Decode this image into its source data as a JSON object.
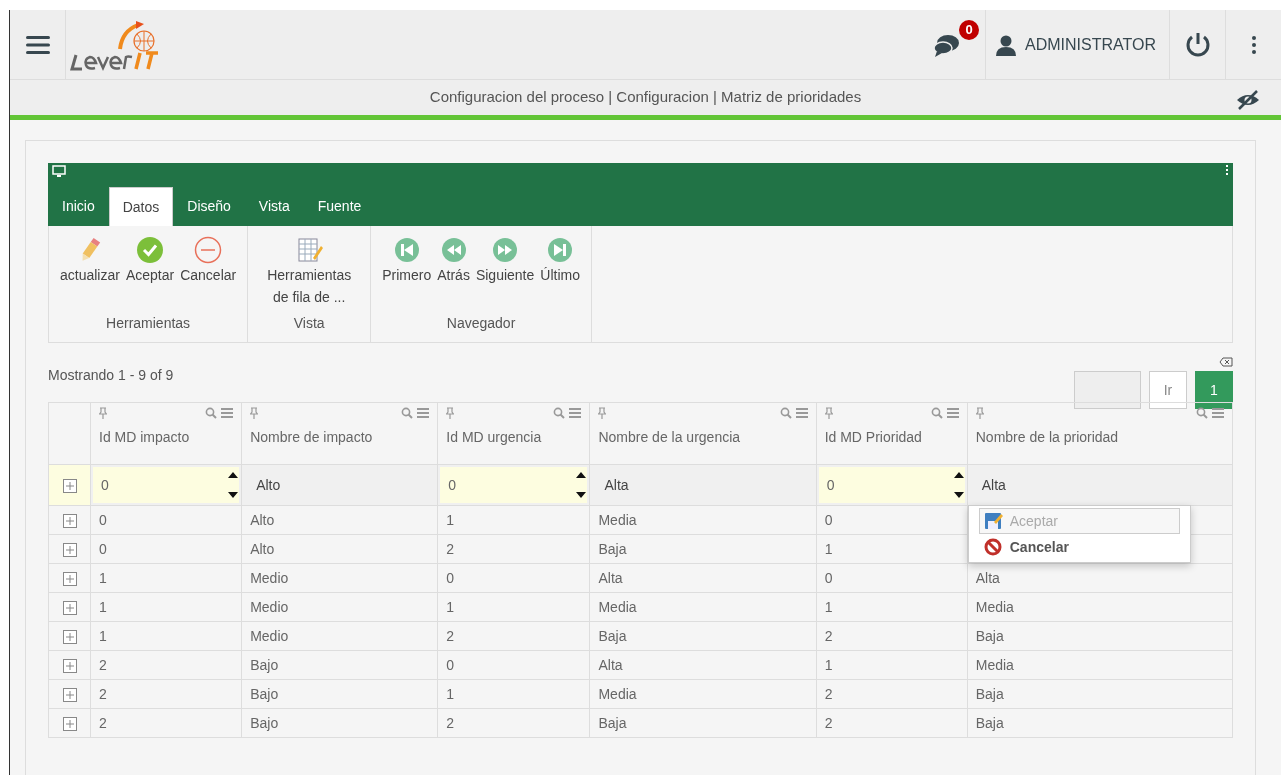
{
  "header": {
    "notifications": "0",
    "user": "ADMINISTRATOR"
  },
  "breadcrumb": "Configuracion del proceso | Configuracion | Matriz de prioridades",
  "ribbon": {
    "tabs": [
      {
        "label": "Inicio",
        "selected": false
      },
      {
        "label": "Datos",
        "selected": true
      },
      {
        "label": "Diseño",
        "selected": false
      },
      {
        "label": "Vista",
        "selected": false
      },
      {
        "label": "Fuente",
        "selected": false
      }
    ],
    "groups": [
      {
        "label": "Herramientas",
        "buttons": [
          {
            "label": "actualizar",
            "kind": "pencil"
          },
          {
            "label": "Aceptar",
            "kind": "accept"
          },
          {
            "label": "Cancelar",
            "kind": "cancel"
          }
        ]
      },
      {
        "label": "Vista",
        "buttons": [
          {
            "label": "Herramientas de fila de ...",
            "kind": "sheet"
          }
        ]
      },
      {
        "label": "Navegador",
        "buttons": [
          {
            "label": "Primero",
            "kind": "first"
          },
          {
            "label": "Atrás",
            "kind": "prev"
          },
          {
            "label": "Siguiente",
            "kind": "next"
          },
          {
            "label": "Último",
            "kind": "last"
          }
        ]
      }
    ]
  },
  "pager": {
    "summary": "Mostrando 1 - 9 of 9",
    "go": "Ir",
    "pages": [
      {
        "label": "1",
        "selected": true
      }
    ]
  },
  "table": {
    "columns": [
      {
        "label": "Id MD impacto",
        "kind": "number"
      },
      {
        "label": "Nombre de impacto",
        "kind": "text"
      },
      {
        "label": "Id MD urgencia",
        "kind": "number"
      },
      {
        "label": "Nombre de la urgencia",
        "kind": "text"
      },
      {
        "label": "Id MD Prioridad",
        "kind": "number"
      },
      {
        "label": "Nombre de la prioridad",
        "kind": "text"
      }
    ],
    "edit_row": [
      "0",
      "Alto",
      "0",
      "Alta",
      "0",
      "Alta"
    ],
    "rows": [
      [
        "0",
        "Alto",
        "1",
        "Media",
        "0"
      ],
      [
        "0",
        "Alto",
        "2",
        "Baja",
        "1"
      ],
      [
        "1",
        "Medio",
        "0",
        "Alta",
        "0",
        "Alta"
      ],
      [
        "1",
        "Medio",
        "1",
        "Media",
        "1",
        "Media"
      ],
      [
        "1",
        "Medio",
        "2",
        "Baja",
        "2",
        "Baja"
      ],
      [
        "2",
        "Bajo",
        "0",
        "Alta",
        "1",
        "Media"
      ],
      [
        "2",
        "Bajo",
        "1",
        "Media",
        "2",
        "Baja"
      ],
      [
        "2",
        "Bajo",
        "2",
        "Baja",
        "2",
        "Baja"
      ]
    ]
  },
  "popup": {
    "items": [
      {
        "label": "Aceptar",
        "kind": "save",
        "disabled": true
      },
      {
        "label": "Cancelar",
        "kind": "cancel",
        "disabled": false
      }
    ]
  }
}
